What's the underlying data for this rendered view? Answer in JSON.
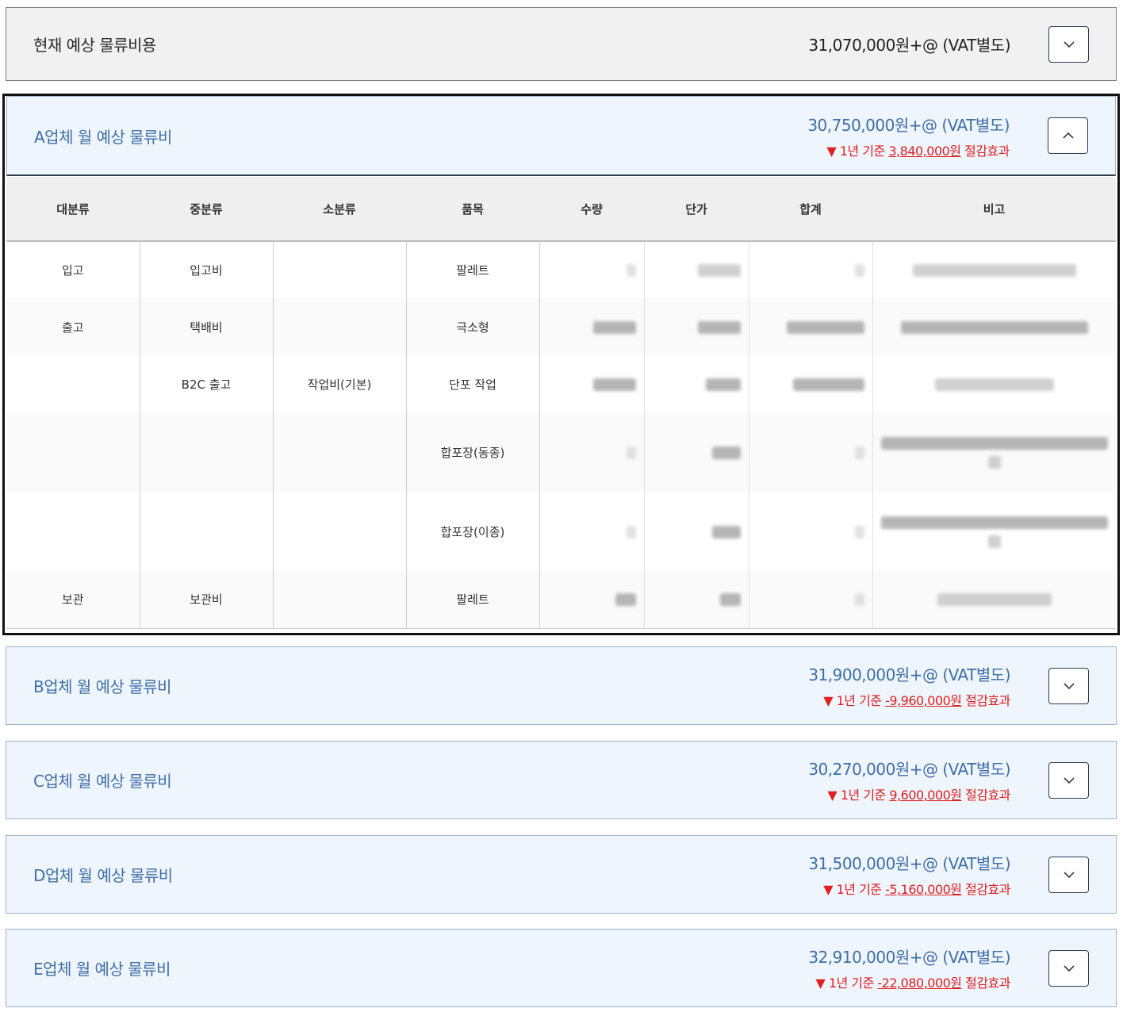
{
  "current": {
    "title": "현재 예상 물류비용",
    "amount": "31,070,000원+@ (VAT별도)"
  },
  "vendors": [
    {
      "title": "A업체 월 예상 물류비",
      "amount": "30,750,000원+@ (VAT별도)",
      "saving_prefix": "▼ 1년 기준 ",
      "saving_value": "3,840,000원",
      "saving_suffix": " 절감효과",
      "expanded": true
    },
    {
      "title": "B업체 월 예상 물류비",
      "amount": "31,900,000원+@ (VAT별도)",
      "saving_prefix": "▼ 1년 기준 ",
      "saving_value": "-9,960,000원",
      "saving_suffix": " 절감효과",
      "expanded": false
    },
    {
      "title": "C업체 월 예상 물류비",
      "amount": "30,270,000원+@ (VAT별도)",
      "saving_prefix": "▼ 1년 기준 ",
      "saving_value": "9,600,000원",
      "saving_suffix": " 절감효과",
      "expanded": false
    },
    {
      "title": "D업체 월 예상 물류비",
      "amount": "31,500,000원+@ (VAT별도)",
      "saving_prefix": "▼ 1년 기준 ",
      "saving_value": "-5,160,000원",
      "saving_suffix": " 절감효과",
      "expanded": false
    },
    {
      "title": "E업체 월 예상 물류비",
      "amount": "32,910,000원+@ (VAT별도)",
      "saving_prefix": "▼ 1년 기준 ",
      "saving_value": "-22,080,000원",
      "saving_suffix": " 절감효과",
      "expanded": false
    }
  ],
  "table": {
    "headers": [
      "대분류",
      "중분류",
      "소분류",
      "품목",
      "수량",
      "단가",
      "합계",
      "비고"
    ],
    "rows": [
      {
        "c1": "입고",
        "c2": "입고비",
        "c3": "",
        "c4": "팔레트"
      },
      {
        "c1": "출고",
        "c2": "택배비",
        "c3": "",
        "c4": "극소형"
      },
      {
        "c1": "",
        "c2": "B2C 출고",
        "c3": "작업비(기본)",
        "c4": "단포 작업"
      },
      {
        "c1": "",
        "c2": "",
        "c3": "",
        "c4": "합포장(동종)"
      },
      {
        "c1": "",
        "c2": "",
        "c3": "",
        "c4": "합포장(이종)"
      },
      {
        "c1": "보관",
        "c2": "보관비",
        "c3": "",
        "c4": "팔레트"
      }
    ]
  },
  "colors": {
    "accent": "#3f6fa6",
    "saving": "#e02020",
    "vendor_bg": "#eef5fd",
    "current_bg": "#f1f1f1"
  },
  "icons": {
    "collapse": "chevron-up-icon",
    "expand": "chevron-down-icon"
  }
}
